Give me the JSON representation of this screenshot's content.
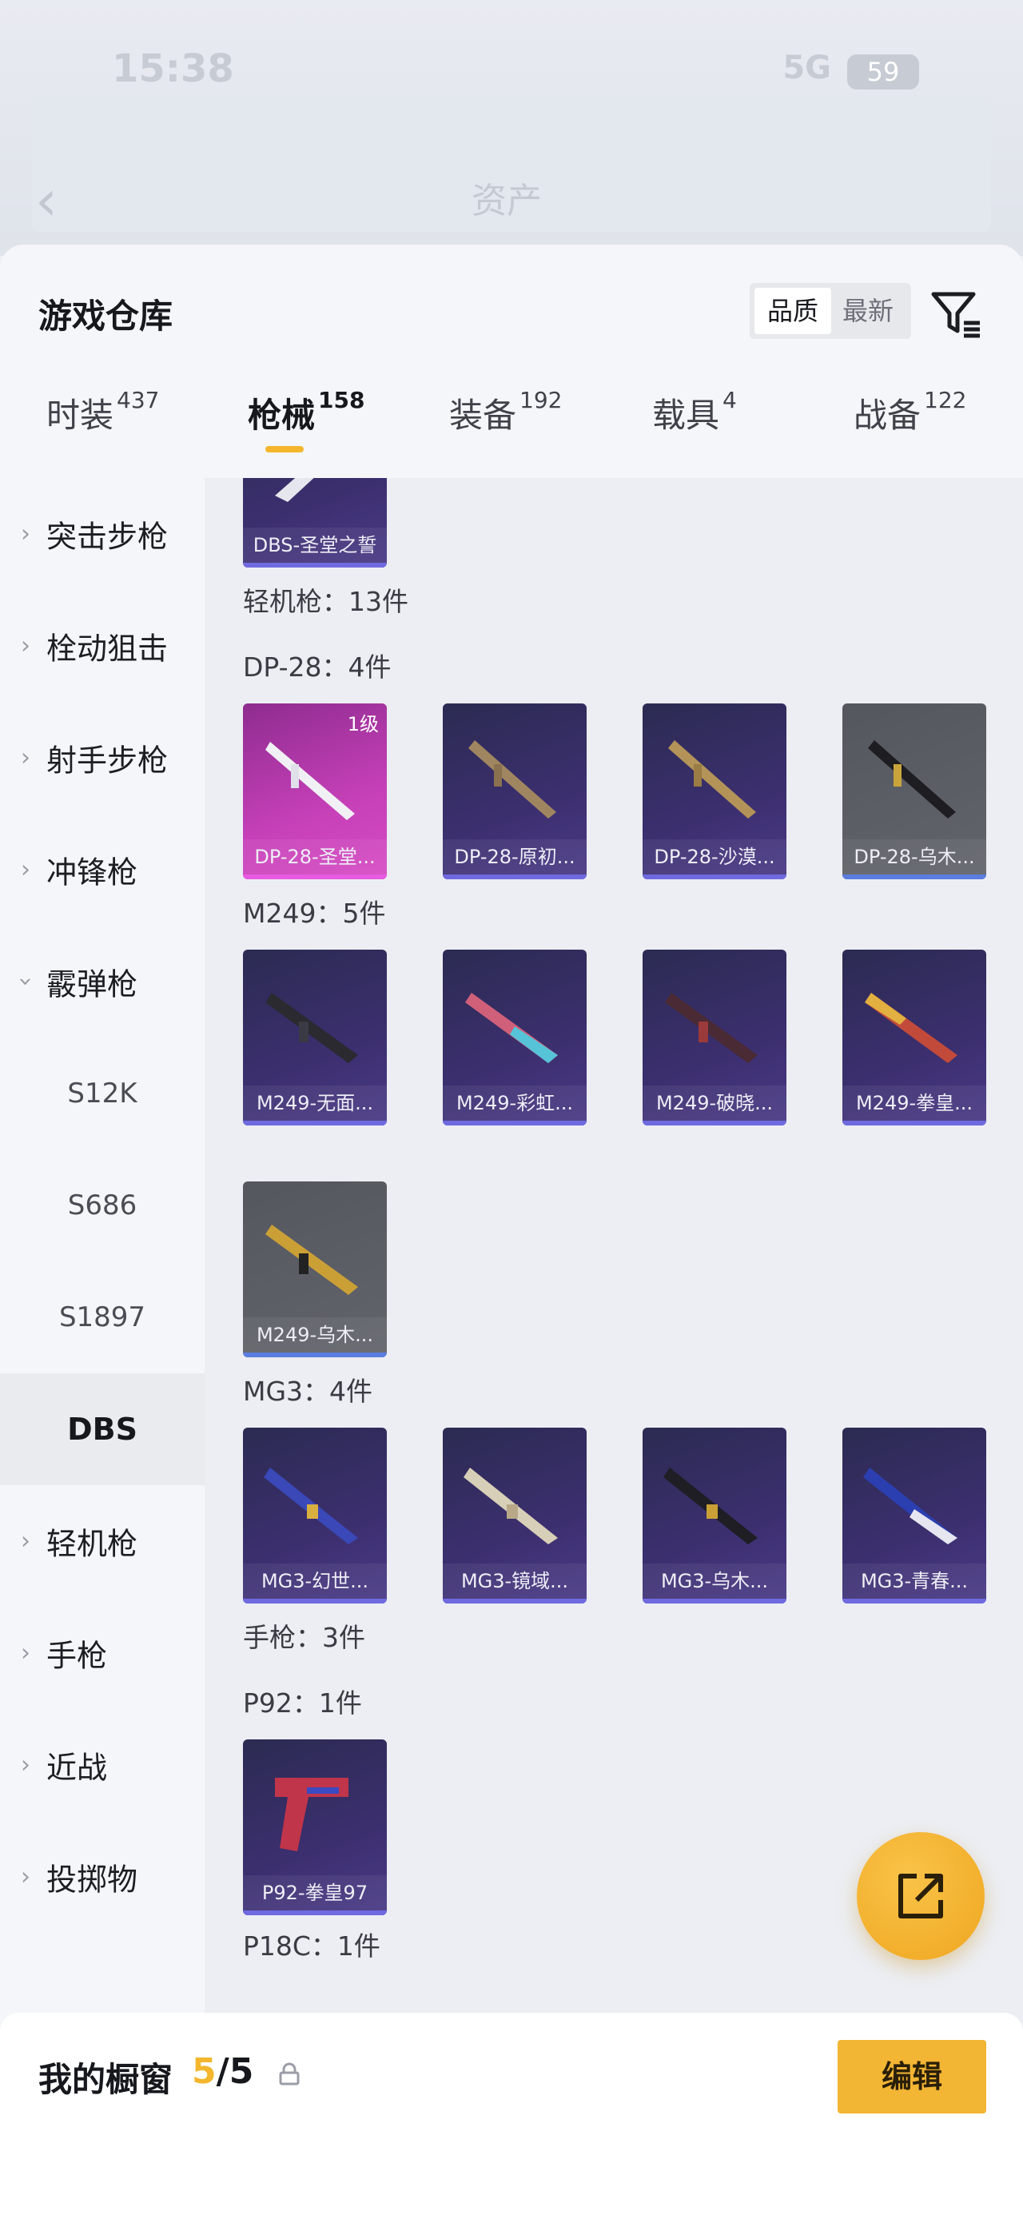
{
  "status_bar": {
    "time": "15:38",
    "network": "5G",
    "battery": "59"
  },
  "nav": {
    "ghost_title": "资产"
  },
  "header": {
    "title": "游戏仓库",
    "sort_options": [
      "品质",
      "最新"
    ]
  },
  "tabs": [
    {
      "label": "时装",
      "count": "437"
    },
    {
      "label": "枪械",
      "count": "158"
    },
    {
      "label": "装备",
      "count": "192"
    },
    {
      "label": "载具",
      "count": "4"
    },
    {
      "label": "战备",
      "count": "122"
    }
  ],
  "sidebar": {
    "categories": [
      "突击步枪",
      "栓动狙击",
      "射手步枪",
      "冲锋枪",
      "霰弹枪"
    ],
    "subitems": [
      "S12K",
      "S686",
      "S1897",
      "DBS"
    ],
    "lower_categories": [
      "轻机枪",
      "手枪",
      "近战",
      "投掷物"
    ]
  },
  "content": {
    "top_card": "DBS-圣堂之誓",
    "lmg_header": "轻机枪：13件",
    "dp28_header": "DP-28：4件",
    "dp28_cards": [
      "DP-28-圣堂...",
      "DP-28-原初...",
      "DP-28-沙漠...",
      "DP-28-乌木..."
    ],
    "dp28_level": "1级",
    "m249_header": "M249：5件",
    "m249_cards": [
      "M249-无面...",
      "M249-彩虹...",
      "M249-破晓...",
      "M249-拳皇...",
      "M249-乌木..."
    ],
    "mg3_header": "MG3：4件",
    "mg3_cards": [
      "MG3-幻世...",
      "MG3-镜域...",
      "MG3-乌木...",
      "MG3-青春..."
    ],
    "pistol_header": "手枪：3件",
    "p92_header": "P92：1件",
    "p92_cards": [
      "P92-拳皇97"
    ],
    "p18c_header": "P18C：1件"
  },
  "bottom": {
    "showcase_label": "我的橱窗",
    "current": "5",
    "total": "/5",
    "edit_label": "编辑"
  },
  "colors": {
    "accent": "#f3b62c",
    "card_purple": "#3c2f6f",
    "card_pink": "#c640b8",
    "card_grey": "#5f6168"
  }
}
